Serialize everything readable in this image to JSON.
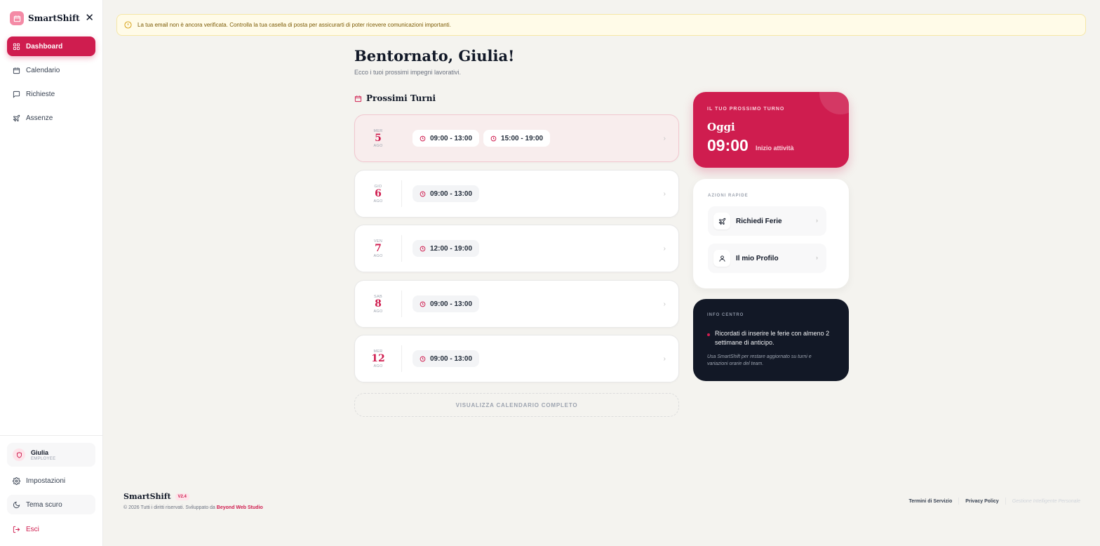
{
  "app": {
    "name": "SmartShift"
  },
  "sidebar": {
    "items": [
      {
        "label": "Dashboard"
      },
      {
        "label": "Calendario"
      },
      {
        "label": "Richieste"
      },
      {
        "label": "Assenze"
      }
    ],
    "user": {
      "name": "Giulia",
      "role": "EMPLOYEE"
    },
    "settings": "Impostazioni",
    "theme": "Tema scuro",
    "logout": "Esci"
  },
  "banner": {
    "text": "La tua email non è ancora verificata. Controlla la tua casella di posta per assicurarti di poter ricevere comunicazioni importanti."
  },
  "header": {
    "greeting": "Bentornato, Giulia!",
    "subtitle": "Ecco i tuoi prossimi impegni lavorativi."
  },
  "shifts": {
    "title": "Prossimi Turni",
    "items": [
      {
        "dow": "MER",
        "day": "5",
        "month": "AGO",
        "slots": [
          "09:00 - 13:00",
          "15:00 - 19:00"
        ]
      },
      {
        "dow": "GIO",
        "day": "6",
        "month": "AGO",
        "slots": [
          "09:00 - 13:00"
        ]
      },
      {
        "dow": "VEN",
        "day": "7",
        "month": "AGO",
        "slots": [
          "12:00 - 19:00"
        ]
      },
      {
        "dow": "SAB",
        "day": "8",
        "month": "AGO",
        "slots": [
          "09:00 - 13:00"
        ]
      },
      {
        "dow": "MER",
        "day": "12",
        "month": "AGO",
        "slots": [
          "09:00 - 13:00"
        ]
      }
    ],
    "calendar_button": "VISUALIZZA CALENDARIO COMPLETO"
  },
  "next_shift": {
    "label": "IL TUO PROSSIMO TURNO",
    "day": "Oggi",
    "time": "09:00",
    "note": "Inizio attività"
  },
  "quick_actions": {
    "label": "AZIONI RAPIDE",
    "items": [
      {
        "label": "Richiedi Ferie"
      },
      {
        "label": "Il mio Profilo"
      }
    ]
  },
  "info": {
    "label": "INFO CENTRO",
    "text": "Ricordati di inserire le ferie con almeno 2 settimane di anticipo.",
    "note": "Usa SmartShift per restare aggiornato su turni e variazioni orarie del team."
  },
  "footer": {
    "brand": "SmartShift",
    "version": "V2.4",
    "copyright": "© 2026 Tutti i diritti riservati. Sviluppato da",
    "studio": "Beyond Web Studio",
    "terms": "Termini di Servizio",
    "privacy": "Privacy Policy",
    "tagline": "Gestione Intelligente Personale"
  },
  "colors": {
    "accent": "#cf1d4f",
    "dark_card": "#121826",
    "background": "#f4f3ef"
  }
}
